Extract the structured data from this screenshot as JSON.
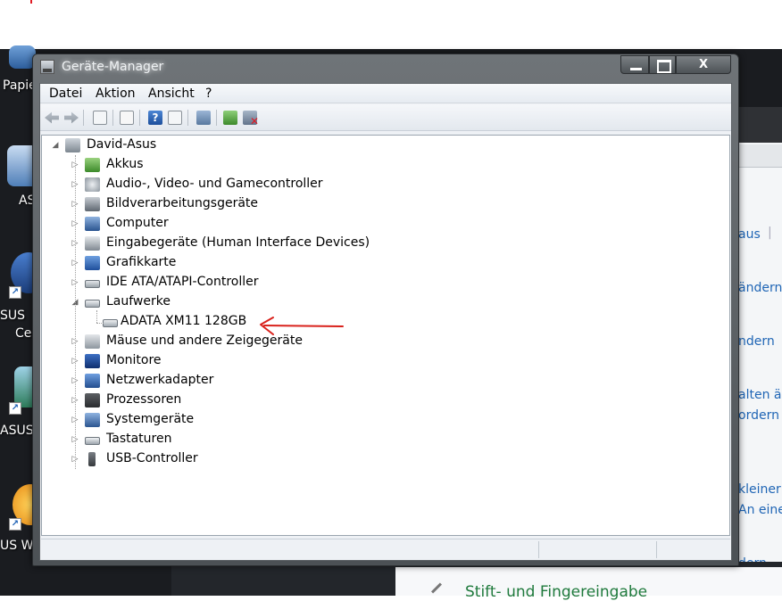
{
  "desktop": {
    "labels": [
      "Papie",
      "AS",
      "SUS",
      "Ce",
      "ASUS",
      "US We"
    ],
    "bg_links": [
      "aus",
      "ändern",
      "ndern",
      "alten är",
      "ordern",
      "kleiner",
      "An eine",
      "dern"
    ],
    "bg_bottom_link": "Stift- und Fingereingabe"
  },
  "window": {
    "title": "Geräte-Manager",
    "close_glyph": "X"
  },
  "menu": {
    "items": [
      "Datei",
      "Aktion",
      "Ansicht",
      "?"
    ]
  },
  "toolbar": {
    "icons": [
      "back-icon",
      "forward-icon",
      "show-hide-console-tree-icon",
      "properties-icon",
      "help-icon",
      "view-icon",
      "scan-hardware-icon",
      "update-driver-icon",
      "uninstall-icon"
    ]
  },
  "tree": {
    "root": "David-Asus",
    "items": [
      {
        "label": "Akkus",
        "expanded": false,
        "icon": "battery-icon"
      },
      {
        "label": "Audio-, Video- und Gamecontroller",
        "expanded": false,
        "icon": "speaker-icon"
      },
      {
        "label": "Bildverarbeitungsgeräte",
        "expanded": false,
        "icon": "camera-icon"
      },
      {
        "label": "Computer",
        "expanded": false,
        "icon": "computer-icon"
      },
      {
        "label": "Eingabegeräte (Human Interface Devices)",
        "expanded": false,
        "icon": "hid-icon"
      },
      {
        "label": "Grafikkarte",
        "expanded": false,
        "icon": "display-adapter-icon"
      },
      {
        "label": "IDE ATA/ATAPI-Controller",
        "expanded": false,
        "icon": "ide-controller-icon"
      },
      {
        "label": "Laufwerke",
        "expanded": true,
        "icon": "disk-drive-icon"
      },
      {
        "label": "ADATA XM11 128GB",
        "child": true,
        "icon": "disk-drive-icon"
      },
      {
        "label": "Mäuse und andere Zeigegeräte",
        "expanded": false,
        "icon": "mouse-icon"
      },
      {
        "label": "Monitore",
        "expanded": false,
        "icon": "monitor-icon"
      },
      {
        "label": "Netzwerkadapter",
        "expanded": false,
        "icon": "network-adapter-icon"
      },
      {
        "label": "Prozessoren",
        "expanded": false,
        "icon": "processor-icon"
      },
      {
        "label": "Systemgeräte",
        "expanded": false,
        "icon": "system-devices-icon"
      },
      {
        "label": "Tastaturen",
        "expanded": false,
        "icon": "keyboard-icon"
      },
      {
        "label": "USB-Controller",
        "expanded": false,
        "icon": "usb-icon"
      }
    ]
  },
  "annotation": {
    "color": "#d9221c"
  },
  "colors": {
    "tree_text": "#000000",
    "link": "#1f65b5"
  }
}
